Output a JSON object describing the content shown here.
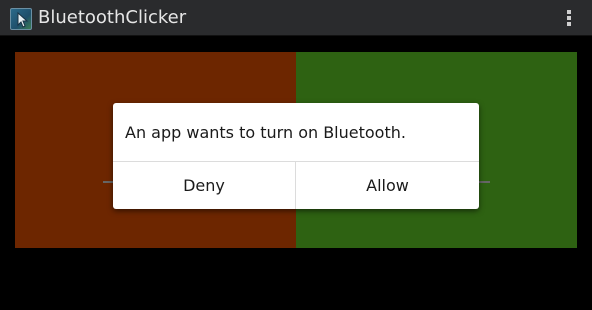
{
  "app": {
    "title": "BluetoothClicker",
    "icon": "bluetooth-clicker-app-icon"
  },
  "actionbar": {
    "overflow_icon": "more-vert-icon"
  },
  "panels": {
    "left_color": "#6d2600",
    "right_color": "#2e6212"
  },
  "dialog": {
    "message": "An app wants to turn on Bluetooth.",
    "deny_label": "Deny",
    "allow_label": "Allow"
  }
}
